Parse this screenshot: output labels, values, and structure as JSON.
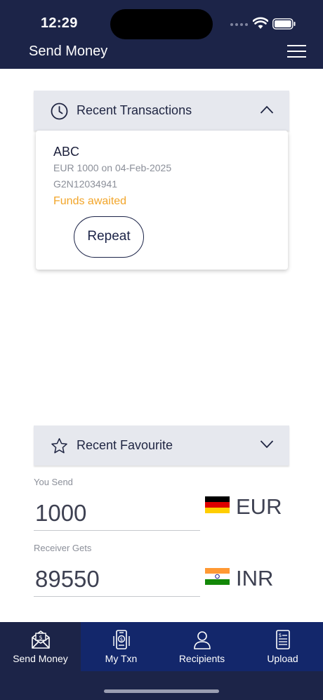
{
  "status_bar": {
    "time": "12:29"
  },
  "header": {
    "title": "Send Money"
  },
  "recent_transactions": {
    "title": "Recent Transactions",
    "items": [
      {
        "name": "ABC",
        "summary": "EUR 1000 on 04-Feb-2025",
        "reference": "G2N12034941",
        "status": "Funds awaited",
        "action_label": "Repeat"
      }
    ]
  },
  "recent_favourite": {
    "title": "Recent Favourite"
  },
  "send": {
    "label": "You Send",
    "amount": "1000",
    "currency": "EUR"
  },
  "receive": {
    "label": "Receiver Gets",
    "amount": "89550",
    "currency": "INR"
  },
  "bottom_nav": [
    {
      "label": "Send Money",
      "icon": "envelope-money-icon"
    },
    {
      "label": "My Txn",
      "icon": "phone-money-icon"
    },
    {
      "label": "Recipients",
      "icon": "person-icon"
    },
    {
      "label": "Upload",
      "icon": "document-icon"
    }
  ],
  "colors": {
    "header": "#1c2448",
    "nav_inactive": "#13276b",
    "status_pending": "#f2a529"
  }
}
